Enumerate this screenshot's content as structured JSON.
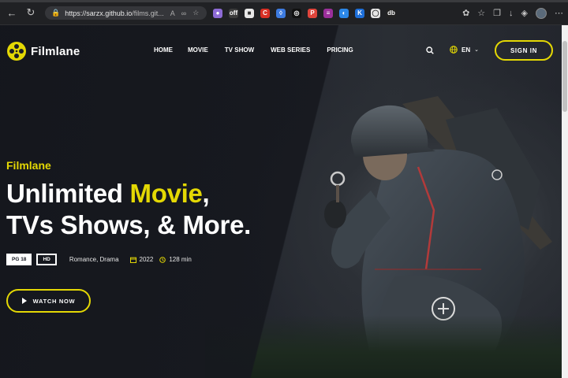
{
  "browser": {
    "url_host": "https://sarzx.github.io",
    "url_path": "/films.git...",
    "zoom_icon": "text-size-icon",
    "extensions": [
      {
        "name": "ext-purple",
        "color": "#8e6bd6",
        "glyph": "●"
      },
      {
        "name": "ext-off",
        "color": "#3c3c3c",
        "glyph": "off"
      },
      {
        "name": "ext-square",
        "color": "#e8e8e8",
        "glyph": "■"
      },
      {
        "name": "ext-red",
        "color": "#d93025",
        "glyph": "C"
      },
      {
        "name": "ext-drop",
        "color": "#3d7be0",
        "glyph": "◊"
      },
      {
        "name": "ext-black",
        "color": "#111111",
        "glyph": "◎"
      },
      {
        "name": "ext-redsq",
        "color": "#e0453c",
        "glyph": "P"
      },
      {
        "name": "ext-magenta",
        "color": "#9b2f9b",
        "glyph": "≡"
      },
      {
        "name": "ext-blue",
        "color": "#2b87e8",
        "glyph": "◐"
      },
      {
        "name": "ext-k",
        "color": "#1e6fd9",
        "glyph": "K"
      },
      {
        "name": "ext-cam",
        "color": "#e6e6e6",
        "glyph": "◯"
      },
      {
        "name": "ext-bw",
        "color": "#222222",
        "glyph": "db"
      }
    ]
  },
  "brand": {
    "name": "Filmlane",
    "accent": "#e4d804"
  },
  "nav": {
    "home": "HOME",
    "movie": "MOVIE",
    "tv_show": "TV SHOW",
    "web_series": "WEB SERIES",
    "pricing": "PRICING"
  },
  "header": {
    "language": "EN",
    "sign_in": "SIGN IN"
  },
  "hero": {
    "subtitle": "Filmlane",
    "title_line1_pre": "Unlimited ",
    "title_line1_accent": "Movie",
    "title_line1_post": ",",
    "title_line2": "TVs Shows, & More.",
    "badge_rating": "PG 18",
    "badge_quality": "HD",
    "genres": "Romance,  Drama",
    "year": "2022",
    "duration": "128 min",
    "cta": "WATCH NOW"
  }
}
